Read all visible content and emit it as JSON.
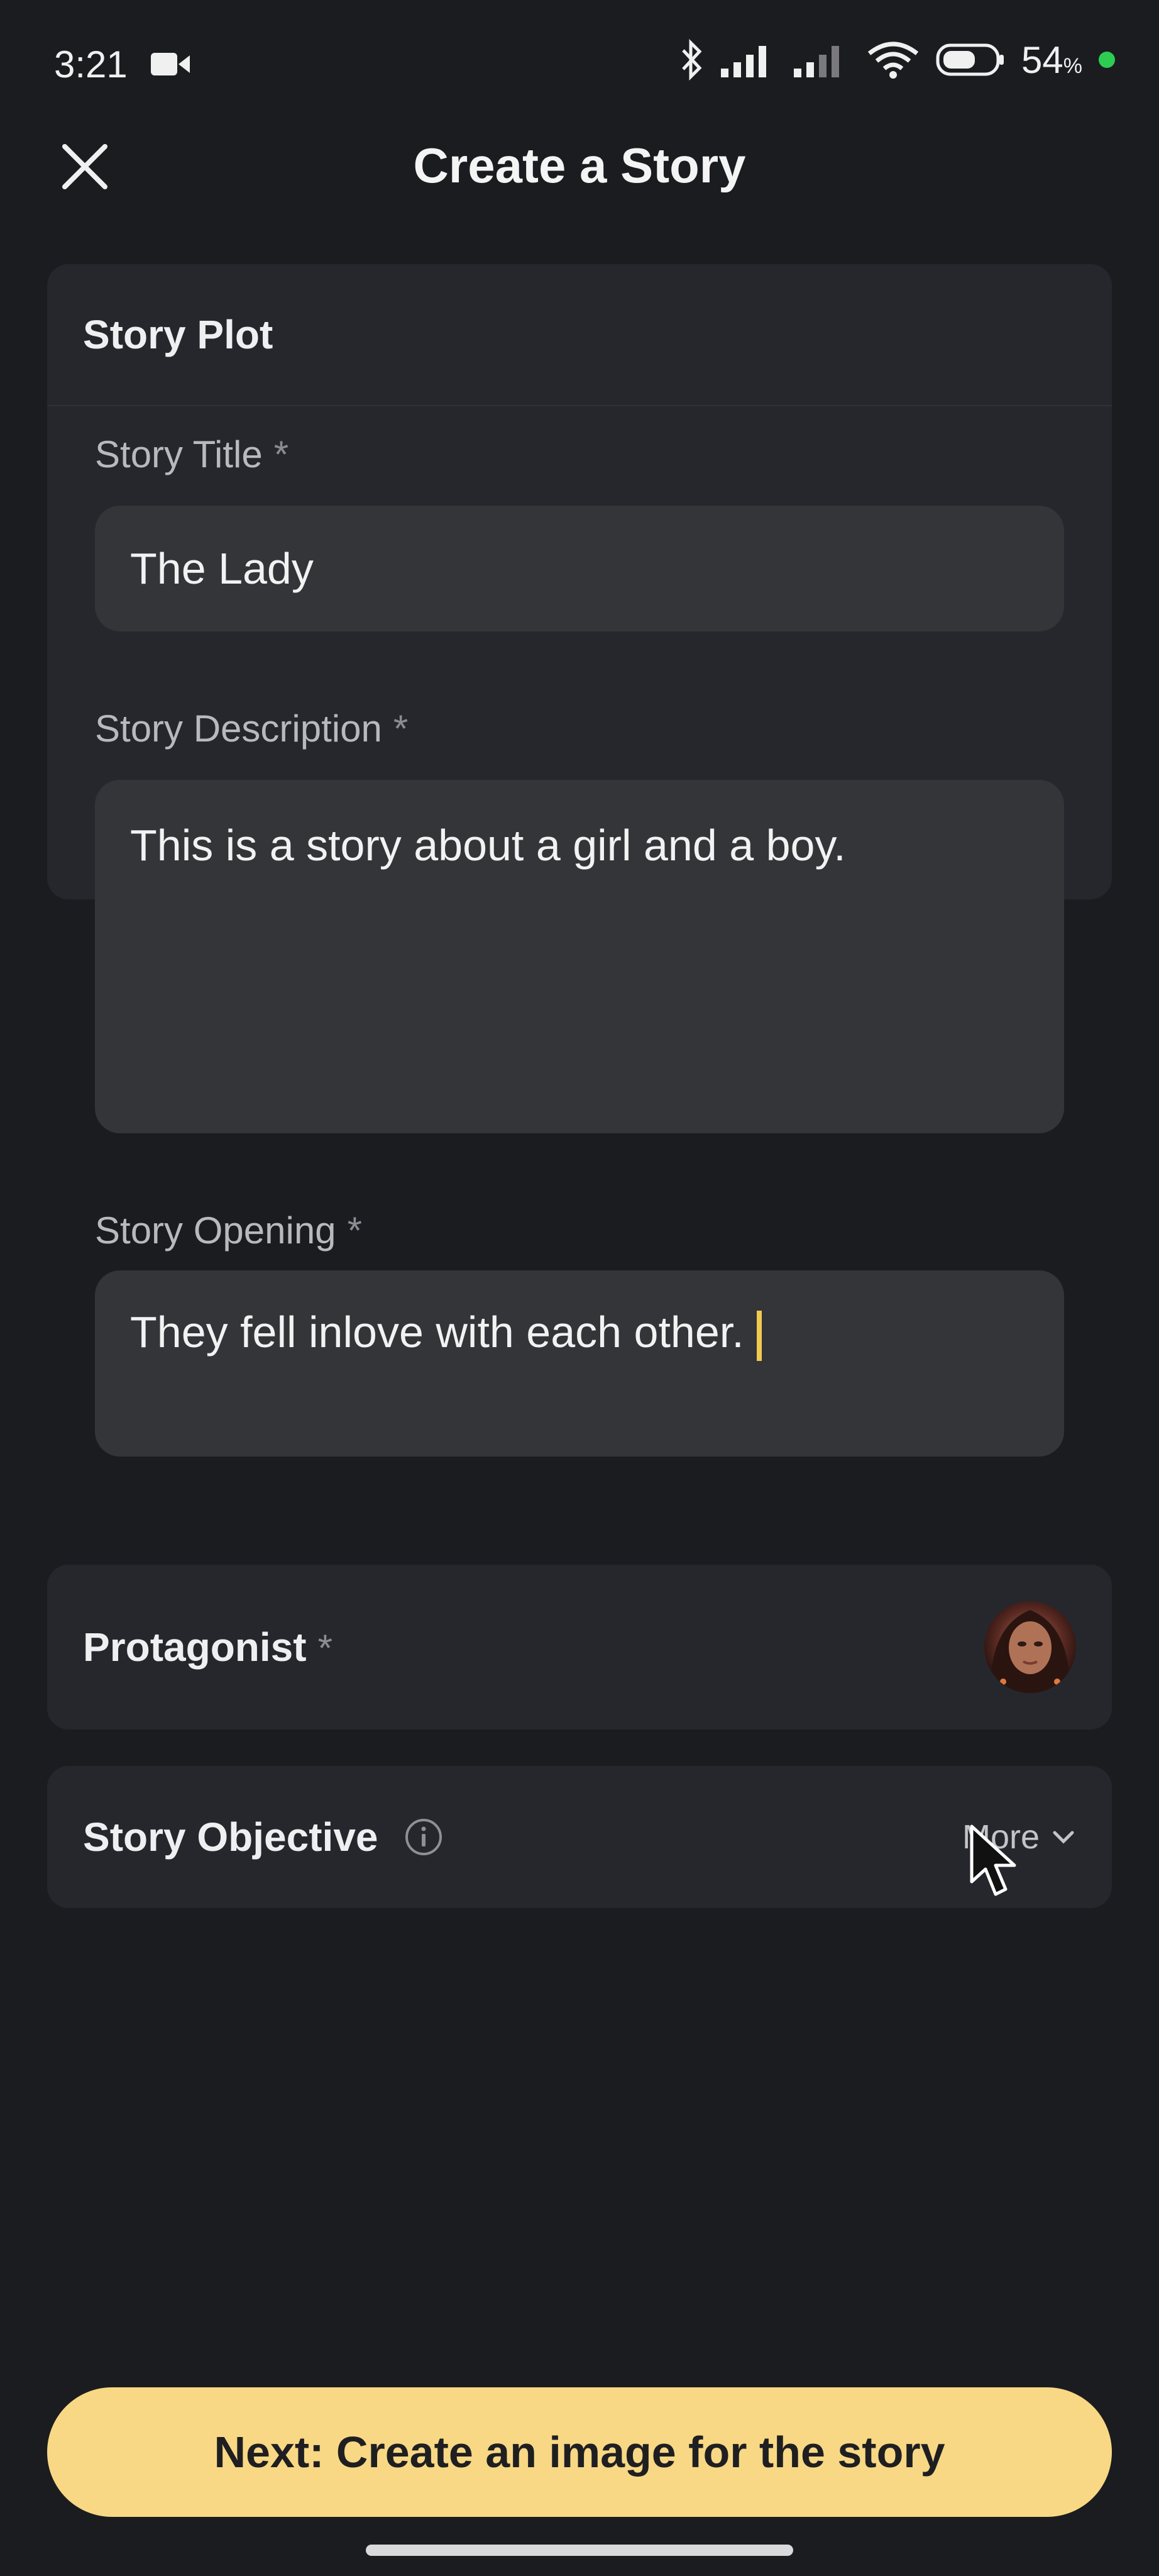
{
  "status_bar": {
    "time": "3:21",
    "battery_percent": "54",
    "battery_percent_sign": "%",
    "icons": [
      "video-camera-icon",
      "bluetooth-icon",
      "signal-icon",
      "signal-icon",
      "wifi-icon",
      "battery-icon"
    ]
  },
  "header": {
    "title": "Create a Story",
    "close_icon": "close-icon"
  },
  "story_plot": {
    "heading": "Story Plot",
    "title_label": "Story Title",
    "title_value": "The Lady",
    "description_label": "Story Description",
    "description_value": "This is a story about a girl and a boy.",
    "opening_label": "Story Opening",
    "opening_value": "They fell inlove with each other.",
    "required_marker": "*"
  },
  "protagonist": {
    "label": "Protagonist",
    "required_marker": "*"
  },
  "objective": {
    "label": "Story Objective",
    "more_label": "More"
  },
  "next_button": {
    "label": "Next: Create an image for the story"
  },
  "colors": {
    "background": "#1b1c20",
    "card": "#26272c",
    "field": "#343539",
    "accent": "#f8d884",
    "caret": "#f1c94f"
  }
}
